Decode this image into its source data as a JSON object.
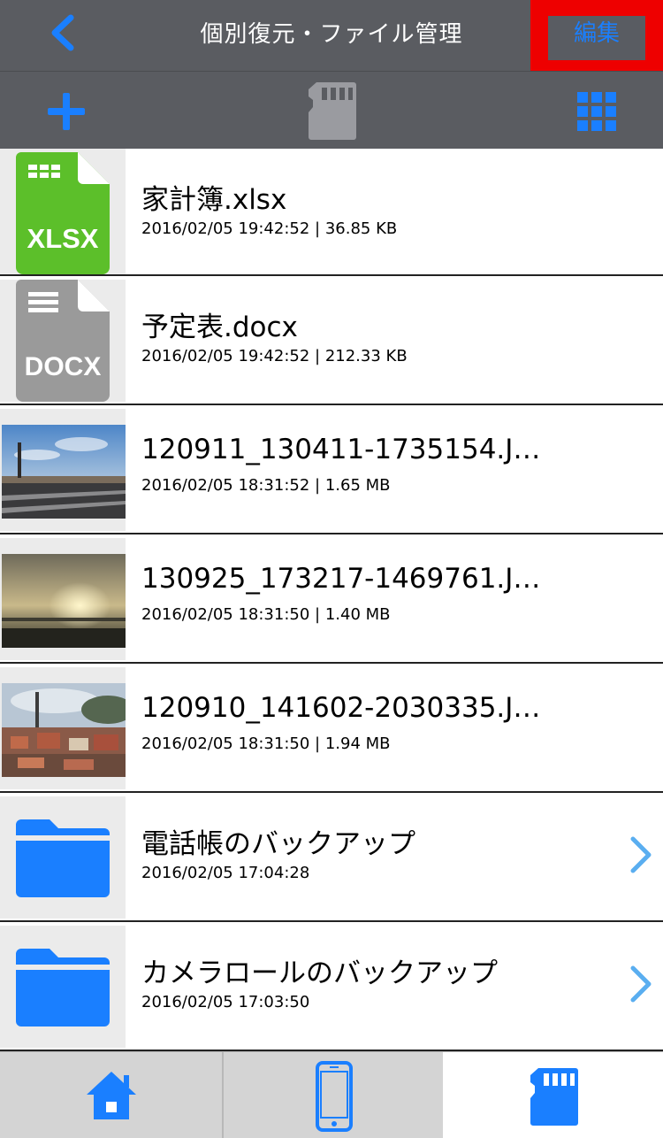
{
  "navbar": {
    "title": "個別復元・ファイル管理",
    "edit_label": "編集",
    "back_icon": "chevron-left-icon"
  },
  "toolbar": {
    "add_icon": "plus-icon",
    "storage_icon": "sd-card-icon",
    "view_icon": "grid-icon"
  },
  "files": [
    {
      "name": "家計簿.xlsx",
      "meta": "2016/02/05 19:42:52 | 36.85 KB",
      "kind": "xlsx",
      "badge": "XLSX"
    },
    {
      "name": "予定表.docx",
      "meta": "2016/02/05 19:42:52 | 212.33 KB",
      "kind": "docx",
      "badge": "DOCX"
    },
    {
      "name": "120911_130411-1735154.J…",
      "meta": "2016/02/05 18:31:52 | 1.65 MB",
      "kind": "photo"
    },
    {
      "name": "130925_173217-1469761.J…",
      "meta": "2016/02/05 18:31:50 | 1.40 MB",
      "kind": "photo"
    },
    {
      "name": "120910_141602-2030335.J…",
      "meta": "2016/02/05 18:31:50 | 1.94 MB",
      "kind": "photo"
    },
    {
      "name": "電話帳のバックアップ",
      "meta": "2016/02/05 17:04:28",
      "kind": "folder"
    },
    {
      "name": "カメラロールのバックアップ",
      "meta": "2016/02/05 17:03:50",
      "kind": "folder"
    }
  ],
  "tabs": [
    {
      "icon": "home-icon",
      "selected": false
    },
    {
      "icon": "phone-icon",
      "selected": false
    },
    {
      "icon": "sd-card-icon",
      "selected": true
    }
  ],
  "colors": {
    "accent": "#1a7fff",
    "bar": "#5a5c61",
    "highlight": "#ee0000",
    "xlsx": "#5cbf2a",
    "docx": "#9a9a9a"
  }
}
